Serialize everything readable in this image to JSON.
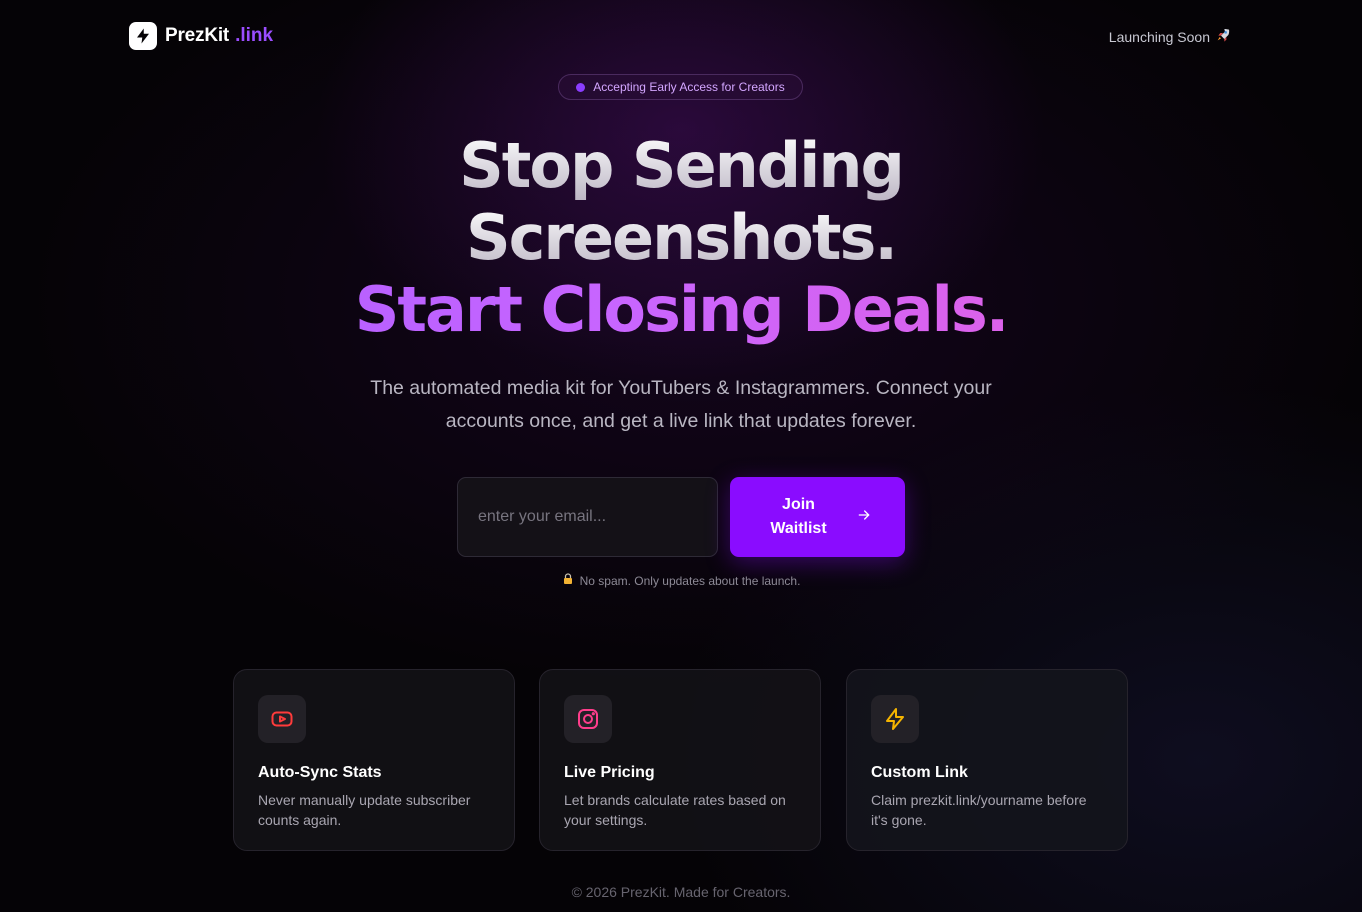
{
  "header": {
    "brand_name": "PrezKit",
    "brand_tld": ".link",
    "brand_icon": "lightning-bolt-icon",
    "status": "Launching Soon",
    "status_icon": "rocket-icon"
  },
  "badge": {
    "label": "Accepting Early Access for Creators"
  },
  "hero": {
    "headline_line_1": "Stop Sending",
    "headline_line_2": "Screenshots.",
    "headline_line_3": "Start Closing Deals.",
    "subheadline_line_1": "The automated media kit for YouTubers & Instagrammers. Connect your",
    "subheadline_line_2": "accounts once, and get a live link that updates forever."
  },
  "form": {
    "email_placeholder": "enter your email...",
    "email_value": "",
    "button_label": "Join Waitlist",
    "button_icon": "arrow-right-icon",
    "note_icon": "lock-icon",
    "note": "No spam. Only updates about the launch."
  },
  "features": [
    {
      "icon": "youtube-icon",
      "title": "Auto-Sync Stats",
      "description": "Never manually update subscriber counts again."
    },
    {
      "icon": "instagram-icon",
      "title": "Live Pricing",
      "description": "Let brands calculate rates based on your settings."
    },
    {
      "icon": "lightning-bolt-icon",
      "title": "Custom Link",
      "description": "Claim prezkit.link/yourname before it's gone."
    }
  ],
  "colors": {
    "accent": "#8a0cff",
    "brand_tld": "#9b4dff",
    "youtube": "#ff3b3b",
    "instagram": "#ff3d8b",
    "bolt": "#f5b400",
    "background": "#050306"
  },
  "footer": {
    "text": "© 2026 PrezKit. Made for Creators."
  }
}
